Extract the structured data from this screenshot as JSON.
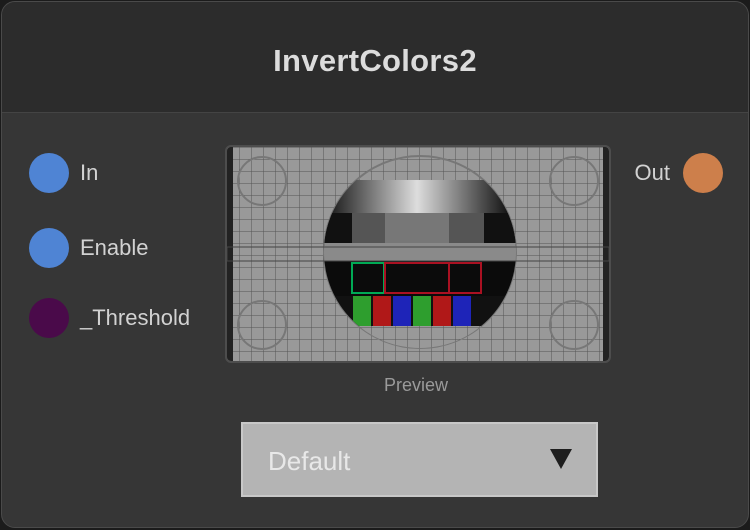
{
  "node": {
    "title": "InvertColors2",
    "inputs": [
      {
        "label": "In",
        "color": "#4f84d4"
      },
      {
        "label": "Enable",
        "color": "#4f84d4"
      },
      {
        "label": "_Threshold",
        "color": "#4a0a4a"
      }
    ],
    "outputs": [
      {
        "label": "Out",
        "color": "#cd7f4b"
      }
    ],
    "preview_label": "Preview",
    "mode_select": {
      "value": "Default"
    }
  }
}
